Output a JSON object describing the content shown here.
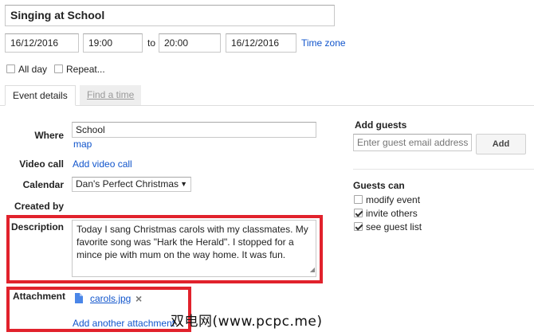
{
  "event": {
    "title": "Singing at School",
    "start_date": "16/12/2016",
    "start_time": "19:00",
    "to_label": "to",
    "end_time": "20:00",
    "end_date": "16/12/2016",
    "time_zone_link": "Time zone",
    "all_day_label": "All day",
    "repeat_label": "Repeat..."
  },
  "tabs": [
    {
      "label": "Event details",
      "active": true
    },
    {
      "label": "Find a time",
      "active": false
    }
  ],
  "details": {
    "where_label": "Where",
    "where_value": "School",
    "map_link": "map",
    "video_call_label": "Video call",
    "add_video_call_link": "Add video call",
    "calendar_label": "Calendar",
    "calendar_value": "Dan's Perfect Christmas",
    "created_by_label": "Created by",
    "description_label": "Description",
    "description_value": "Today I sang Christmas carols with my classmates. My favorite song was \"Hark the Herald\". I stopped for a mince pie with mum on the way home. It was fun.",
    "attachment_label": "Attachment",
    "attachment_file": "carols.jpg",
    "add_attachment_link": "Add another attachment"
  },
  "guests": {
    "add_guests_label": "Add guests",
    "email_placeholder": "Enter guest email addresses",
    "add_button": "Add",
    "guests_can_label": "Guests can",
    "permissions": [
      {
        "label": "modify event",
        "checked": false
      },
      {
        "label": "invite others",
        "checked": true
      },
      {
        "label": "see guest list",
        "checked": true
      }
    ]
  },
  "watermark": "双电网(www.pcpc.me)",
  "colors": {
    "link": "#1155cc",
    "highlight_box": "#e1222c",
    "tab_inactive_bg": "#eeeeee"
  }
}
